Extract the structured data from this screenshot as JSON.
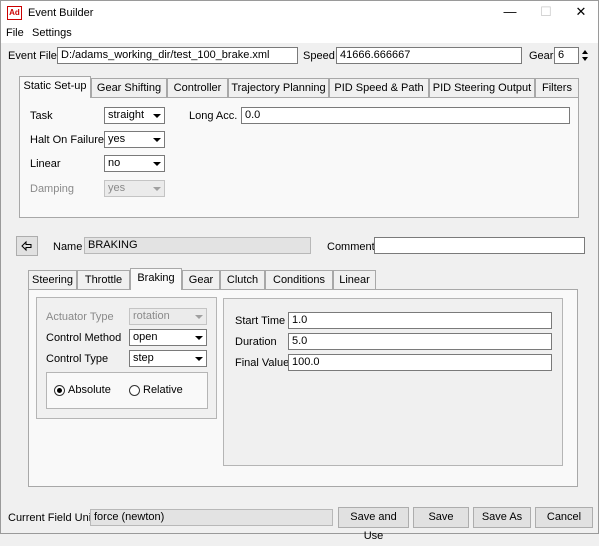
{
  "window": {
    "title": "Event Builder",
    "app_icon_text": "Ad"
  },
  "menu": [
    "File",
    "Settings"
  ],
  "header": {
    "event_file_label": "Event File",
    "event_file_value": "D:/adams_working_dir/test_100_brake.xml",
    "speed_label": "Speed",
    "speed_value": "41666.666667",
    "gear_label": "Gear",
    "gear_value": "6"
  },
  "top_tabs": [
    "Static Set-up",
    "Gear Shifting",
    "Controller",
    "Trajectory Planning",
    "PID Speed & Path",
    "PID Steering Output",
    "Filters"
  ],
  "static_setup": {
    "task_label": "Task",
    "task_value": "straight",
    "halt_label": "Halt On Failure",
    "halt_value": "yes",
    "linear_label": "Linear",
    "linear_value": "no",
    "damping_label": "Damping",
    "damping_value": "yes",
    "long_acc_label": "Long Acc.",
    "long_acc_value": "0.0"
  },
  "mini": {
    "name_label": "Name",
    "name_value": "BRAKING",
    "comment_label": "Comment",
    "comment_value": ""
  },
  "mini_tabs": [
    "Steering",
    "Throttle",
    "Braking",
    "Gear",
    "Clutch",
    "Conditions",
    "Linear"
  ],
  "braking": {
    "actuator_type_label": "Actuator Type",
    "actuator_type_value": "rotation",
    "control_method_label": "Control Method",
    "control_method_value": "open",
    "control_type_label": "Control Type",
    "control_type_value": "step",
    "absolute_label": "Absolute",
    "relative_label": "Relative",
    "start_time_label": "Start Time",
    "start_time_value": "1.0",
    "duration_label": "Duration",
    "duration_value": "5.0",
    "final_value_label": "Final Value",
    "final_value_value": "100.0"
  },
  "footer": {
    "unit_label": "Current Field Unit",
    "unit_value": "force (newton)",
    "save_and_use": "Save and Use",
    "save": "Save",
    "save_as": "Save As",
    "cancel": "Cancel"
  }
}
